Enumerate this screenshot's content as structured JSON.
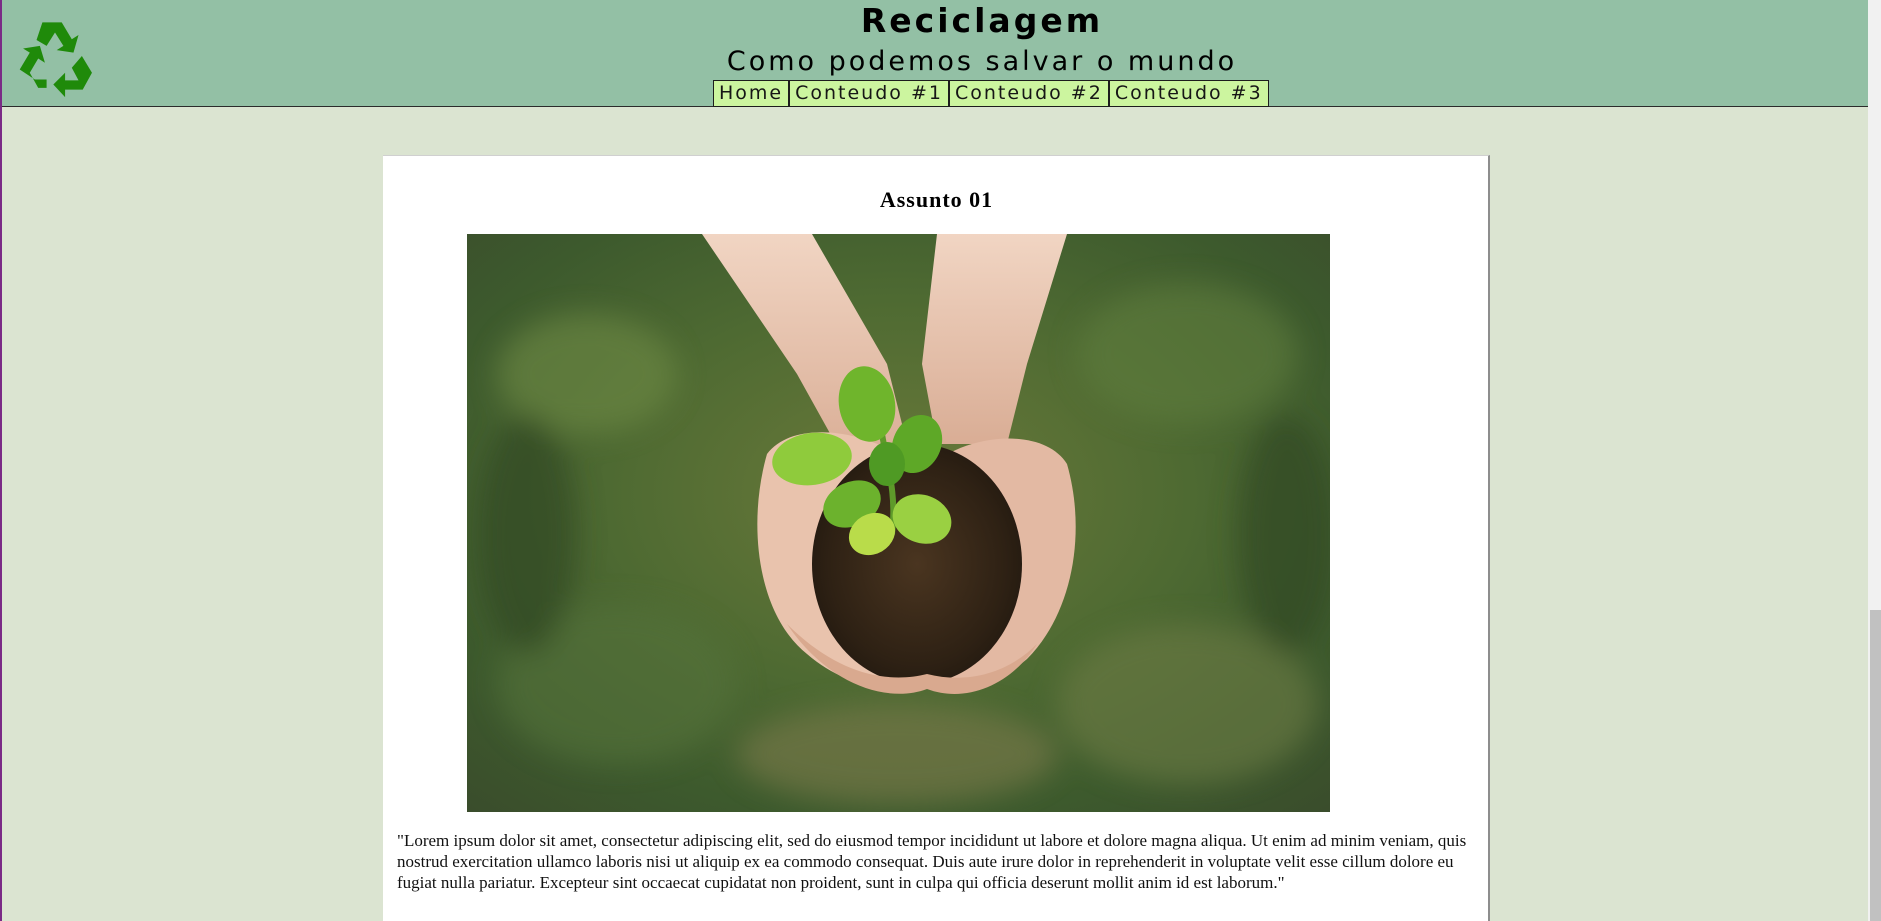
{
  "header": {
    "title": "Reciclagem",
    "subtitle": "Como podemos salvar o mundo"
  },
  "nav": {
    "items": [
      "Home",
      "Conteudo #1",
      "Conteudo #2",
      "Conteudo #3"
    ]
  },
  "article": {
    "title": "Assunto 01",
    "body": "\"Lorem ipsum dolor sit amet, consectetur adipiscing elit, sed do eiusmod tempor incididunt ut labore et dolore magna aliqua. Ut enim ad minim veniam, quis nostrud exercitation ullamco laboris nisi ut aliquip ex ea commodo consequat. Duis aute irure dolor in reprehenderit in voluptate velit esse cillum dolore eu fugiat nulla pariatur. Excepteur sint occaecat cupidatat non proident, sunt in culpa qui officia deserunt mollit anim id est laborum.\""
  },
  "colors": {
    "header_bg": "#93c0a5",
    "page_bg": "#dbe4d1",
    "nav_bg": "#ccf59f",
    "logo_green": "#1f8a0a"
  }
}
